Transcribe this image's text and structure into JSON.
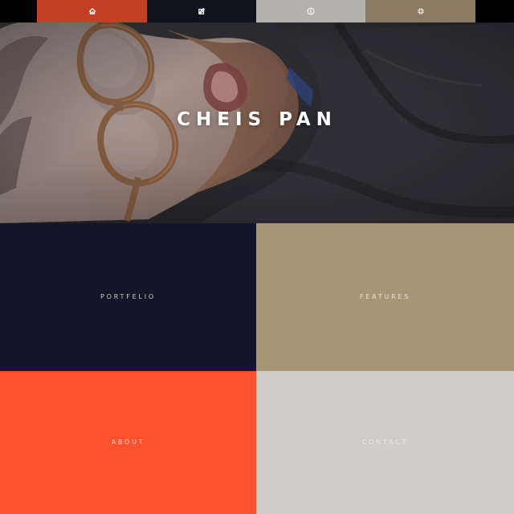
{
  "nav": {
    "tabs": [
      {
        "icon": "home-icon",
        "color": "#c53f25"
      },
      {
        "icon": "edit-icon",
        "color": "#10121c"
      },
      {
        "icon": "info-icon",
        "color": "#b3b1ab"
      },
      {
        "icon": "fullscreen-icon",
        "color": "#8b7a62"
      }
    ]
  },
  "hero": {
    "title": "CHEIS PAN"
  },
  "tiles": [
    {
      "label": "PORTFELIO",
      "color": "#111728"
    },
    {
      "label": "FEATURES",
      "color": "#a79576"
    },
    {
      "label": "ABOUT",
      "color": "#fe522e"
    },
    {
      "label": "CONTACT",
      "color": "#d0ccc6"
    }
  ]
}
